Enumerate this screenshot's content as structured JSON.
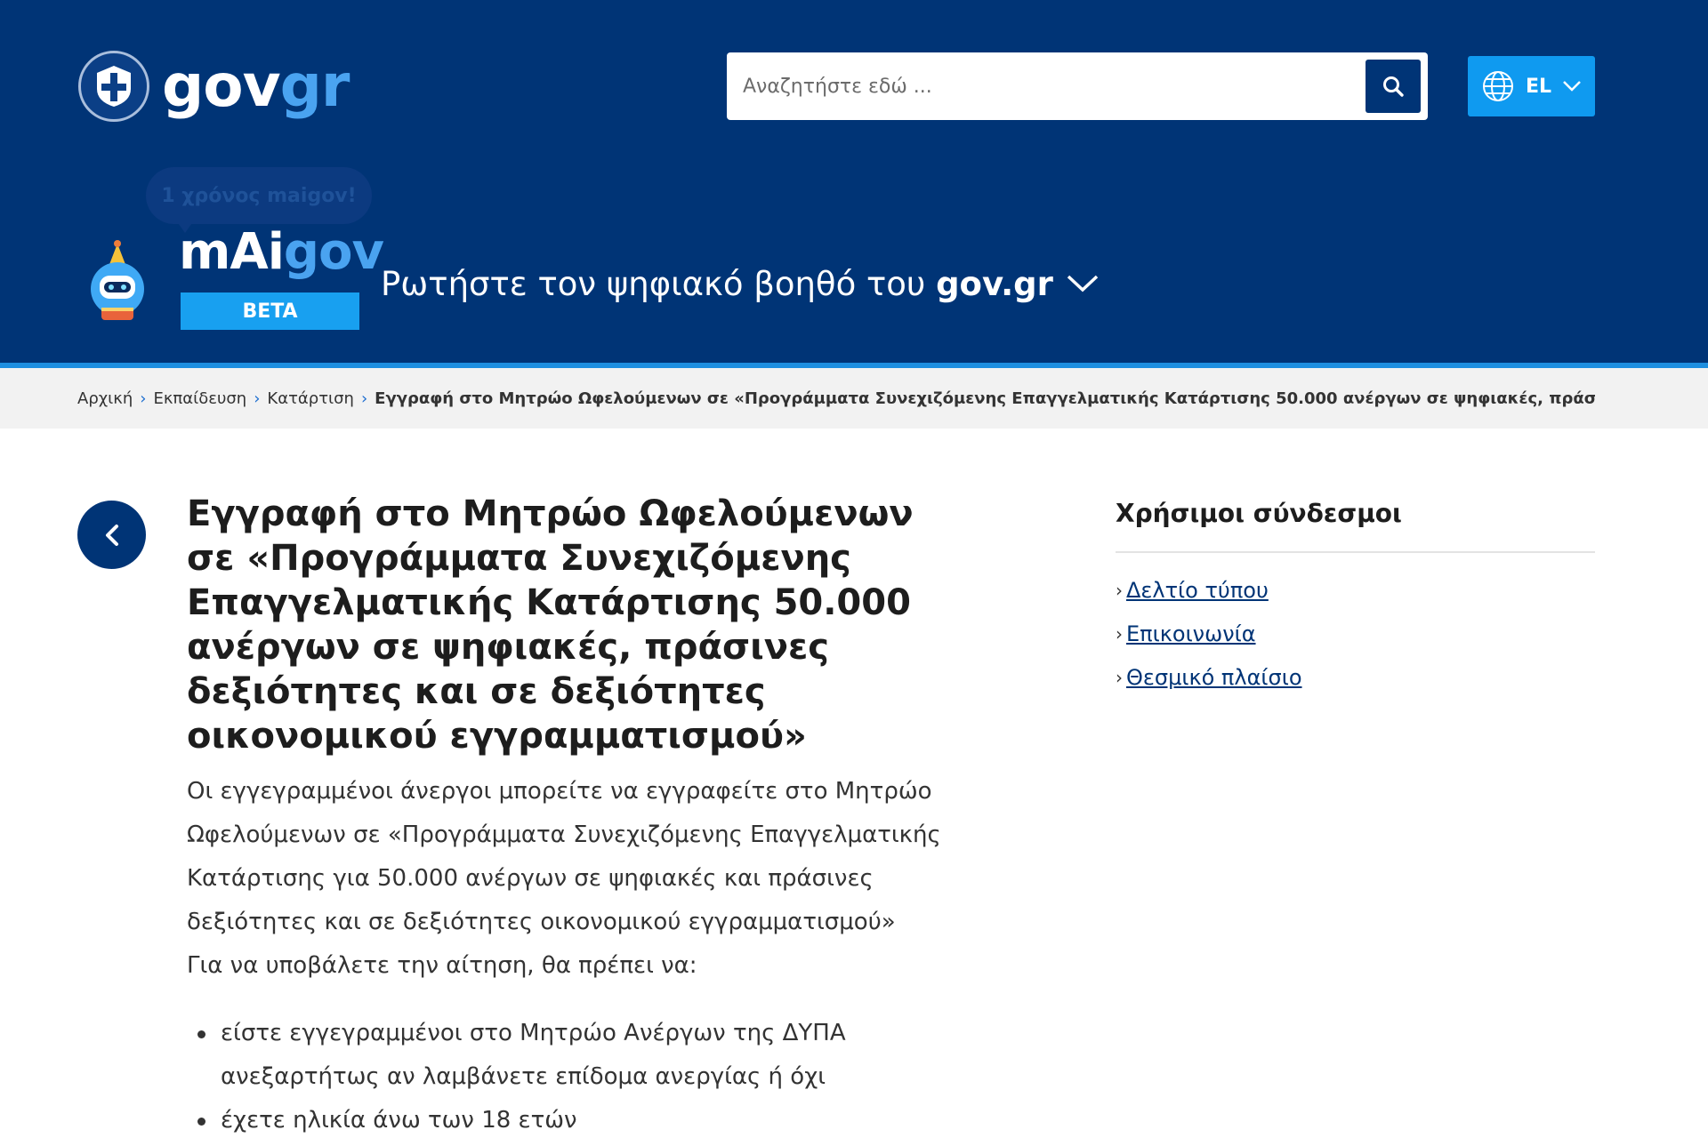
{
  "header": {
    "logo": {
      "main": "gov",
      "accent": "gr"
    },
    "search": {
      "placeholder": "Αναζητήστε εδώ ..."
    },
    "language": {
      "label": "EL"
    }
  },
  "assistant": {
    "bubble": "1 χρόνος maigov!",
    "logo": {
      "main": "mAi",
      "accent": "gov"
    },
    "beta": "BETA",
    "prompt": "Ρωτήστε τον ψηφιακό βοηθό του",
    "prompt_bold": "gov.gr"
  },
  "breadcrumb": {
    "items": [
      "Αρχική",
      "Εκπαίδευση",
      "Κατάρτιση"
    ],
    "current": "Εγγραφή στο Μητρώο Ωφελούμενων σε «Προγράμματα Συνεχιζόμενης Επαγγελματικής Κατάρτισης 50.000 ανέργων σε ψηφιακές, πράσινες δεξιότη"
  },
  "main": {
    "title": "Εγγραφή στο Μητρώο Ωφελούμενων σε «Προγράμματα Συνεχιζόμενης Επαγγελματικής Κατάρτισης 50.000 ανέργων σε ψηφιακές, πράσινες δεξιότητες και σε δεξιότητες οικονομικού εγγραμματισμού»",
    "intro": "Οι εγγεγραμμένοι άνεργοι μπορείτε να εγγραφείτε στο Μητρώο Ωφελούμενων σε «Προγράμματα Συνεχιζόμενης Επαγγελματικής Κατάρτισης για 50.000 ανέργων σε ψηφιακές και πράσινες δεξιότητες και σε δεξιότητες οικονομικού εγγραμματισμού»",
    "requirements_intro": "Για να υποβάλετε την αίτηση, θα πρέπει να:",
    "requirements": [
      "είστε εγγεγραμμένοι στο Μητρώο Ανέργων της ΔΥΠΑ ανεξαρτήτως αν λαμβάνετε επίδομα ανεργίας ή όχι",
      "έχετε ηλικία άνω των 18 ετών"
    ]
  },
  "sidebar": {
    "title": "Χρήσιμοι σύνδεσμοι",
    "links": [
      "Δελτίο τύπου",
      "Επικοινωνία",
      "Θεσμικό πλαίσιο"
    ]
  },
  "colors": {
    "header_bg": "#003476",
    "accent_blue": "#1e8fe0",
    "language_button": "#0f9af0",
    "link": "#003476"
  }
}
